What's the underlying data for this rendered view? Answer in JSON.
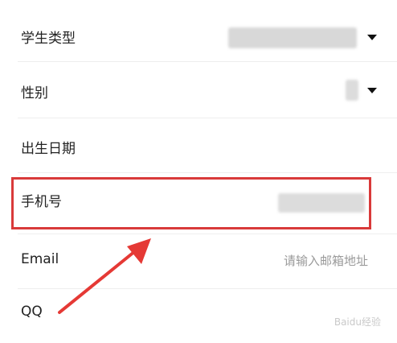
{
  "form": {
    "student_type": {
      "label": "学生类型"
    },
    "gender": {
      "label": "性别"
    },
    "birth_date": {
      "label": "出生日期"
    },
    "phone": {
      "label": "手机号"
    },
    "email": {
      "label": "Email",
      "placeholder": "请输入邮箱地址"
    },
    "qq": {
      "label": "QQ"
    }
  },
  "annotation": {
    "highlight_color": "#d93a3a",
    "arrow_color": "#e53935"
  },
  "watermark": "Baidu经验"
}
